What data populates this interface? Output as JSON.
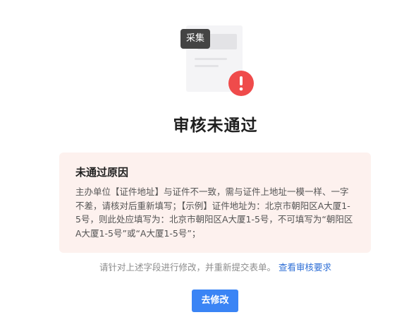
{
  "illustration": {
    "tag_label": "采集",
    "badge_icon": "exclamation-icon",
    "badge_color": "#ef4b4b"
  },
  "status": {
    "title": "审核未通过"
  },
  "reason": {
    "heading": "未通过原因",
    "text": "主办单位【证件地址】与证件不一致，需与证件上地址一模一样、一字不差，请核对后重新填写；【示例】证件地址为：北京市朝阳区A大厦1-5号，则此处应填写为：北京市朝阳区A大厦1-5号，不可填写为“朝阳区A大厦1-5号”或“A大厦1-5号”；",
    "background_color": "#fdf1ee"
  },
  "hint": {
    "text": "请针对上述字段进行修改，并重新提交表单。",
    "link_label": "查看审核要求",
    "link_color": "#2f6fd6"
  },
  "actions": {
    "modify_label": "去修改",
    "button_color": "#3a84f5"
  }
}
